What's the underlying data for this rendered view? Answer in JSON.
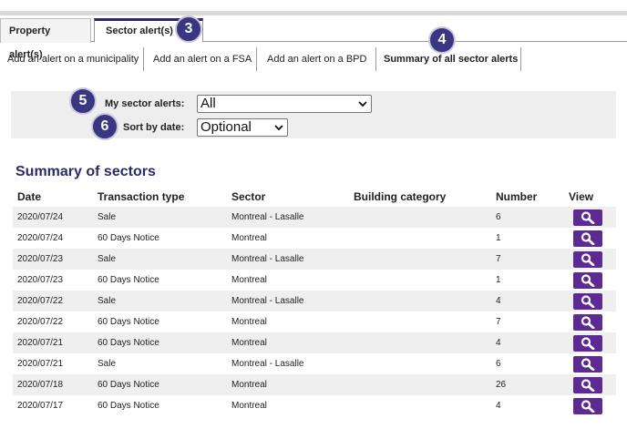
{
  "tabs": [
    {
      "label": "Property alert(s)"
    },
    {
      "label": "Sector alert(s)"
    }
  ],
  "subtabs": [
    {
      "label": "Add an alert on a municipality"
    },
    {
      "label": "Add an alert on a FSA"
    },
    {
      "label": "Add an alert on a BPD"
    },
    {
      "label": "Summary of all sector alerts"
    }
  ],
  "badges": {
    "b3": "3",
    "b4": "4",
    "b5": "5",
    "b6": "6"
  },
  "filters": {
    "my_sector_alerts_label": "My sector alerts:",
    "my_sector_alerts_value": "All",
    "sort_by_date_label": "Sort by date:",
    "sort_by_date_value": "Optional"
  },
  "summary": {
    "title": "Summary of sectors",
    "columns": [
      "Date",
      "Transaction type",
      "Sector",
      "Building category",
      "Number",
      "View"
    ],
    "rows": [
      [
        "2020/07/24",
        "Sale",
        "Montreal - Lasalle",
        "",
        "6"
      ],
      [
        "2020/07/24",
        "60 Days Notice",
        "Montreal",
        "",
        "1"
      ],
      [
        "2020/07/23",
        "Sale",
        "Montreal - Lasalle",
        "",
        "7"
      ],
      [
        "2020/07/23",
        "60 Days Notice",
        "Montreal",
        "",
        "1"
      ],
      [
        "2020/07/22",
        "Sale",
        "Montreal - Lasalle",
        "",
        "4"
      ],
      [
        "2020/07/22",
        "60 Days Notice",
        "Montreal",
        "",
        "7"
      ],
      [
        "2020/07/21",
        "60 Days Notice",
        "Montreal",
        "",
        "4"
      ],
      [
        "2020/07/21",
        "Sale",
        "Montreal - Lasalle",
        "",
        "6"
      ],
      [
        "2020/07/18",
        "60 Days Notice",
        "Montreal",
        "",
        "26"
      ],
      [
        "2020/07/17",
        "60 Days Notice",
        "Montreal",
        "",
        "4"
      ]
    ]
  },
  "colors": {
    "accent": "#2e2a66",
    "badge": "#3a3780",
    "view_button": "#5d2a94",
    "row_shade": "#efefef"
  },
  "icons": {
    "view": "search-icon",
    "select": "chevron-down-icon"
  }
}
